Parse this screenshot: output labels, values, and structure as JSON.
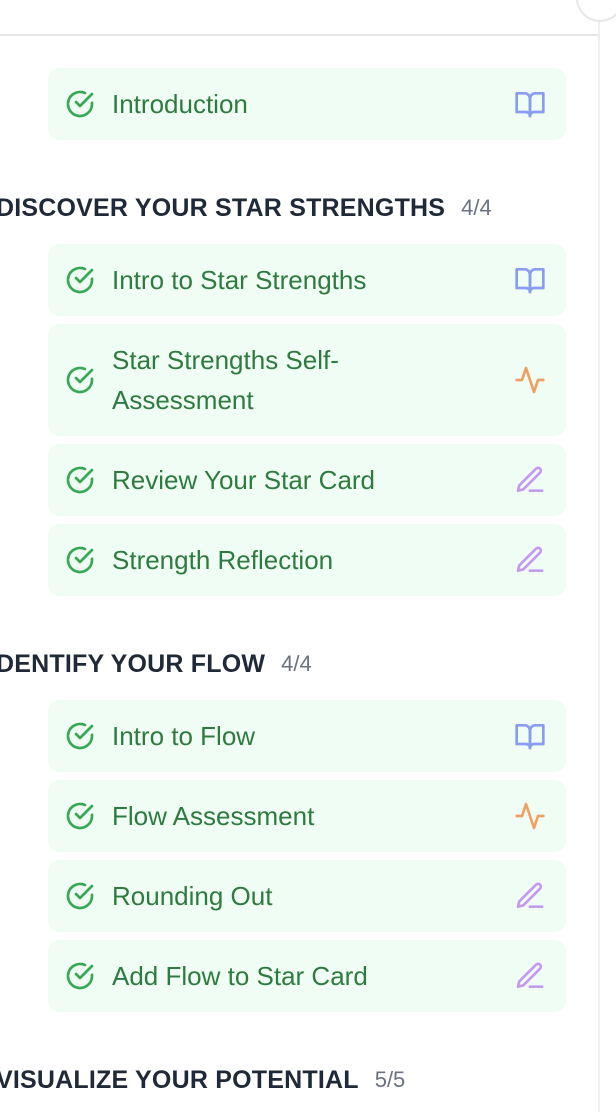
{
  "colors": {
    "step_bg": "#f0fdf4",
    "complete_text": "#2f7a40",
    "check_green": "#3aa757",
    "read_icon": "#8a9cf0",
    "assessment_icon": "#f0a062",
    "write_icon": "#c49af0"
  },
  "intro": {
    "steps": [
      {
        "label": "Introduction",
        "status": "complete",
        "type_icon": "book-open-icon"
      }
    ]
  },
  "sections": [
    {
      "title": "DISCOVER YOUR STAR STRENGTHS",
      "count": "4/4",
      "steps": [
        {
          "label": "Intro to Star Strengths",
          "status": "complete",
          "type_icon": "book-open-icon"
        },
        {
          "label": "Star Strengths Self-Assessment",
          "status": "complete",
          "type_icon": "activity-icon"
        },
        {
          "label": "Review Your Star Card",
          "status": "complete",
          "type_icon": "pen-line-icon"
        },
        {
          "label": "Strength Reflection",
          "status": "complete",
          "type_icon": "pen-line-icon"
        }
      ]
    },
    {
      "title": "DENTIFY YOUR FLOW",
      "count": "4/4",
      "steps": [
        {
          "label": "Intro to Flow",
          "status": "complete",
          "type_icon": "book-open-icon"
        },
        {
          "label": "Flow Assessment",
          "status": "complete",
          "type_icon": "activity-icon"
        },
        {
          "label": "Rounding Out",
          "status": "complete",
          "type_icon": "pen-line-icon"
        },
        {
          "label": "Add Flow to Star Card",
          "status": "complete",
          "type_icon": "pen-line-icon"
        }
      ]
    },
    {
      "title": "VISUALIZE YOUR POTENTIAL",
      "count": "5/5",
      "steps": []
    }
  ]
}
